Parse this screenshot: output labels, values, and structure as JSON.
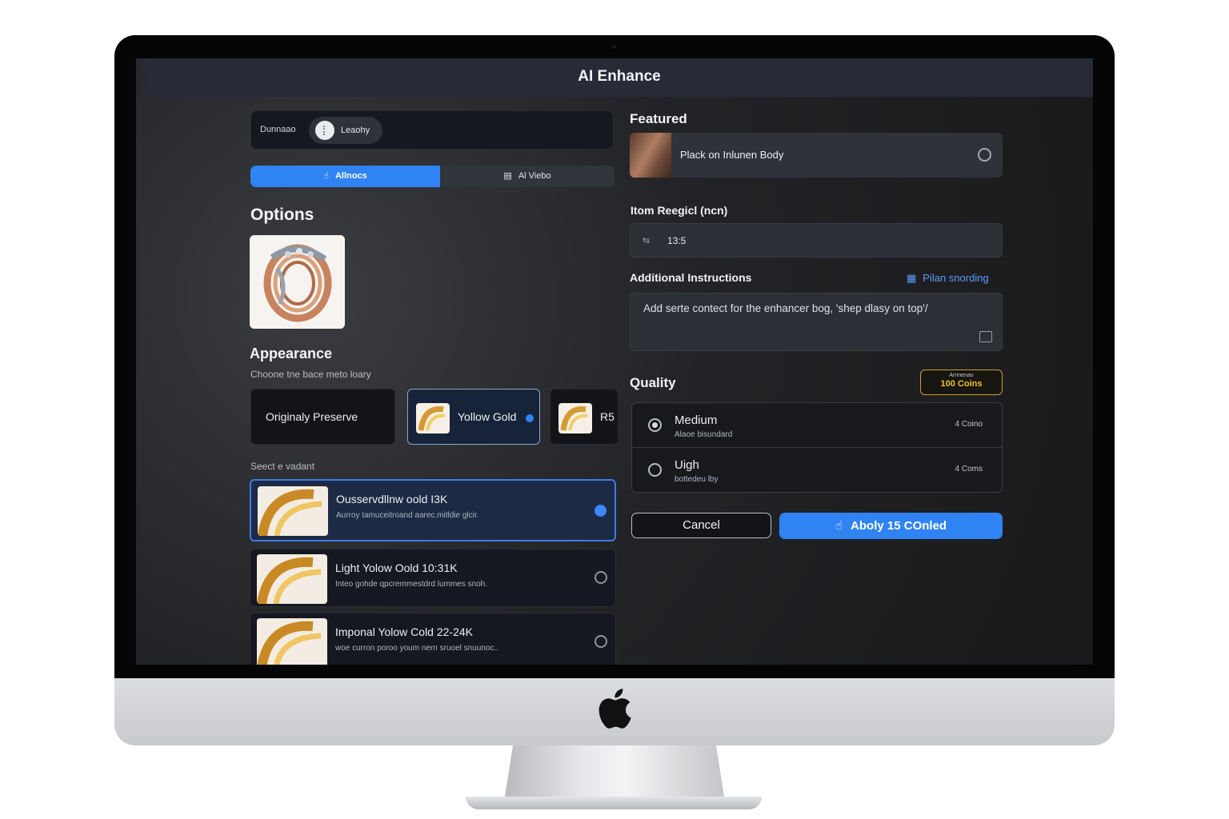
{
  "window": {
    "title": "AI Enhance"
  },
  "top_segment": {
    "label": "Dunnaao",
    "pill_text": "Leaohy"
  },
  "mode_tabs": [
    {
      "label": "Allnocs",
      "icon": "hand-pointer-icon",
      "active": true
    },
    {
      "label": "Al Viebo",
      "icon": "stack-icon",
      "active": false
    }
  ],
  "options": {
    "heading": "Options"
  },
  "appearance": {
    "heading": "Appearance",
    "subtitle": "Choone tne bace meto loary",
    "chips": [
      {
        "label": "Originaly Preserve",
        "selected": false
      },
      {
        "label": "Yollow Gold",
        "selected": true
      },
      {
        "label": "R5",
        "selected": false
      }
    ]
  },
  "variants": {
    "heading": "Seect e vadant",
    "items": [
      {
        "name": "Ousservdllnw oold I3K",
        "desc": "Aurroy tamuceitroand aarec.mitldie glcir.",
        "selected": true
      },
      {
        "name": "Light Yolow Oold 10:31K",
        "desc": "Inteo gohde qpcremmestdrd lummes snoh.",
        "selected": false
      },
      {
        "name": "Imponal Yolow Cold 22-24K",
        "desc": "woe curron poroo youm nern sruoel snuunoc..",
        "selected": false
      }
    ]
  },
  "featured": {
    "heading": "Featured",
    "item_label": "Plack on Inlunen Body"
  },
  "item_region": {
    "label": "Itom Reegicl  (ncn)",
    "value": "13:5"
  },
  "instructions": {
    "label": "Additional Instructions",
    "plan_link": "Pilan snording",
    "text": "Add serte contect for the enhancer bog, 'shep dlasy on top'/"
  },
  "quality": {
    "heading": "Quality",
    "badge_small": "Arnnenau",
    "badge_coins": "100 Coins",
    "options": [
      {
        "name": "Medium",
        "desc": "Alaoe bisundard",
        "cost": "4 Coino",
        "selected": true
      },
      {
        "name": "Uigh",
        "desc": "bottedeu lby",
        "cost": "4 Coms",
        "selected": false
      }
    ]
  },
  "actions": {
    "cancel": "Cancel",
    "apply": "Aboly 15 COnled"
  },
  "colors": {
    "accent": "#2f83f3",
    "gold": "#f1c230",
    "background": "#1e1f22"
  }
}
